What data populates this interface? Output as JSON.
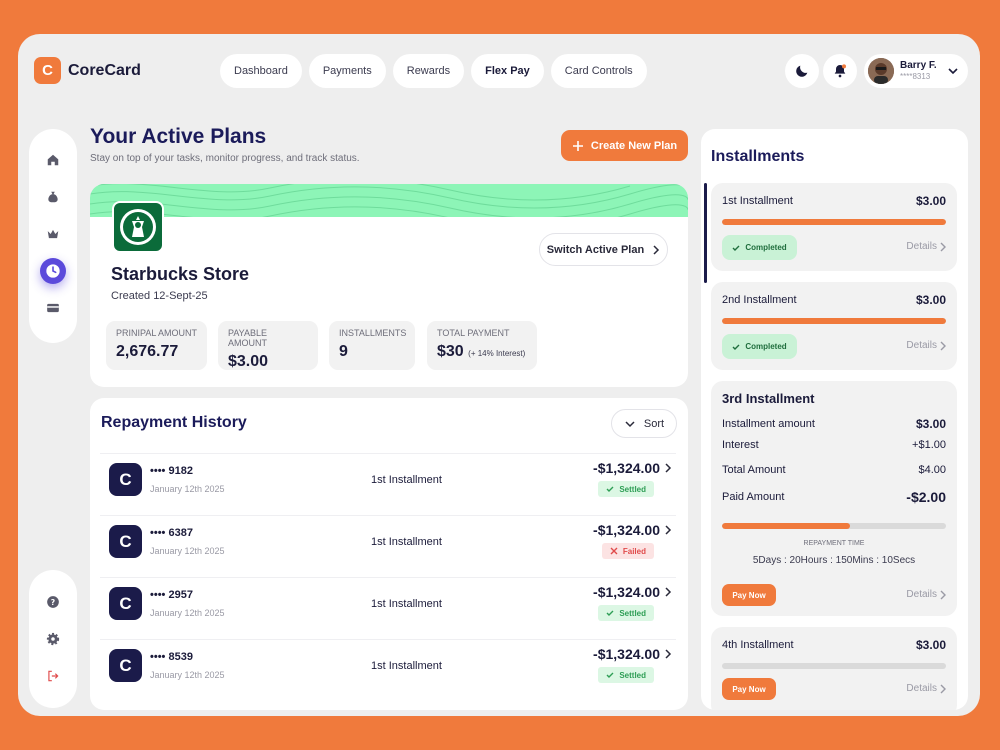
{
  "app": {
    "logo_letter": "C",
    "name": "CoreCard"
  },
  "nav": [
    {
      "label": "Dashboard"
    },
    {
      "label": "Payments"
    },
    {
      "label": "Rewards"
    },
    {
      "label": "Flex Pay"
    },
    {
      "label": "Card Controls"
    }
  ],
  "profile": {
    "name": "Barry F.",
    "card": "****8313"
  },
  "page": {
    "title": "Your Active Plans",
    "subtitle": "Stay on top of your tasks, monitor progress, and track status.",
    "create_label": "Create New Plan"
  },
  "plan": {
    "store": "Starbucks Store",
    "created": "Created 12-Sept-25",
    "switch_label": "Switch Active Plan",
    "stats": [
      {
        "label": "PRINIPAL AMOUNT",
        "value": "2,676.77",
        "note": ""
      },
      {
        "label": "PAYABLE AMOUNT",
        "value": "$3.00",
        "note": ""
      },
      {
        "label": "INSTALLMENTS",
        "value": "9",
        "note": ""
      },
      {
        "label": "TOTAL PAYMENT",
        "value": "$30",
        "note": "(+ 14% Interest)"
      }
    ]
  },
  "repayment": {
    "title": "Repayment History",
    "sort_label": "Sort",
    "rows": [
      {
        "icon": "C",
        "card": "•••• 9182",
        "date": "January 12th 2025",
        "desc": "1st Installment",
        "amount": "-$1,324.00",
        "status": "Settled"
      },
      {
        "icon": "C",
        "card": "•••• 6387",
        "date": "January 12th 2025",
        "desc": "1st Installment",
        "amount": "-$1,324.00",
        "status": "Failed"
      },
      {
        "icon": "C",
        "card": "•••• 2957",
        "date": "January 12th 2025",
        "desc": "1st Installment",
        "amount": "-$1,324.00",
        "status": "Settled"
      },
      {
        "icon": "C",
        "card": "•••• 8539",
        "date": "January 12th 2025",
        "desc": "1st Installment",
        "amount": "-$1,324.00",
        "status": "Settled"
      }
    ]
  },
  "installments": {
    "title": "Installments",
    "items": [
      {
        "name": "1st Installment",
        "amount": "$3.00",
        "progress": 1.0,
        "status": "Completed",
        "details": "Details"
      },
      {
        "name": "2nd Installment",
        "amount": "$3.00",
        "progress": 1.0,
        "status": "Completed",
        "details": "Details"
      },
      {
        "name": "3rd Installment",
        "rows": [
          {
            "label": "Installment amount",
            "value": "$3.00"
          },
          {
            "label": "Interest",
            "value": "+$1.00"
          },
          {
            "label": "Total Amount",
            "value": "$4.00"
          },
          {
            "label": "Paid Amount",
            "value": "-$2.00"
          }
        ],
        "progress": 0.57,
        "time_label": "REPAYMENT TIME",
        "time_value": "5Days : 20Hours : 150Mins : 10Secs",
        "pay_label": "Pay Now",
        "details": "Details"
      },
      {
        "name": "4th Installment",
        "amount": "$3.00",
        "progress": 0.0,
        "pay_label": "Pay Now",
        "details": "Details"
      }
    ]
  },
  "colors": {
    "accent": "#F07A3C",
    "navy": "#1B1B4A",
    "mint": "#8DF5B7",
    "purple": "#5B4ADB"
  }
}
